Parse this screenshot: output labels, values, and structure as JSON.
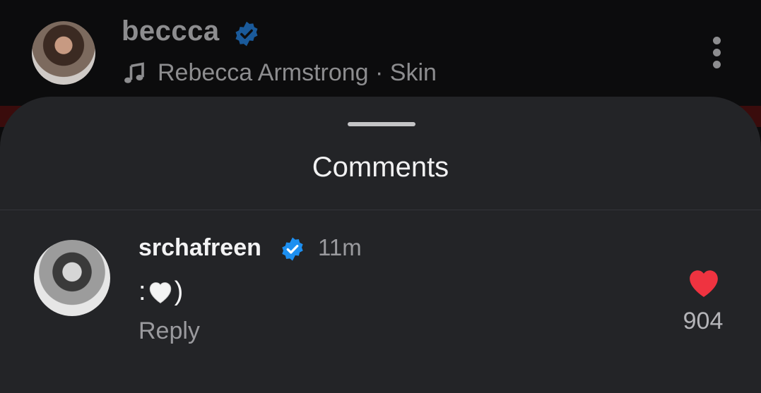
{
  "header": {
    "username": "beccca",
    "song": "Rebecca Armstrong · Skin",
    "verified": true
  },
  "comments_sheet": {
    "title": "Comments",
    "items": [
      {
        "username": "srchafreen",
        "verified": true,
        "time": "11m",
        "text_prefix": ":",
        "text_suffix": ")",
        "reply_label": "Reply",
        "likes": "904",
        "liked": true
      }
    ]
  },
  "colors": {
    "verified_badge": "#1d8ff0",
    "like_heart": "#ef3340",
    "sheet_bg": "#232427"
  }
}
